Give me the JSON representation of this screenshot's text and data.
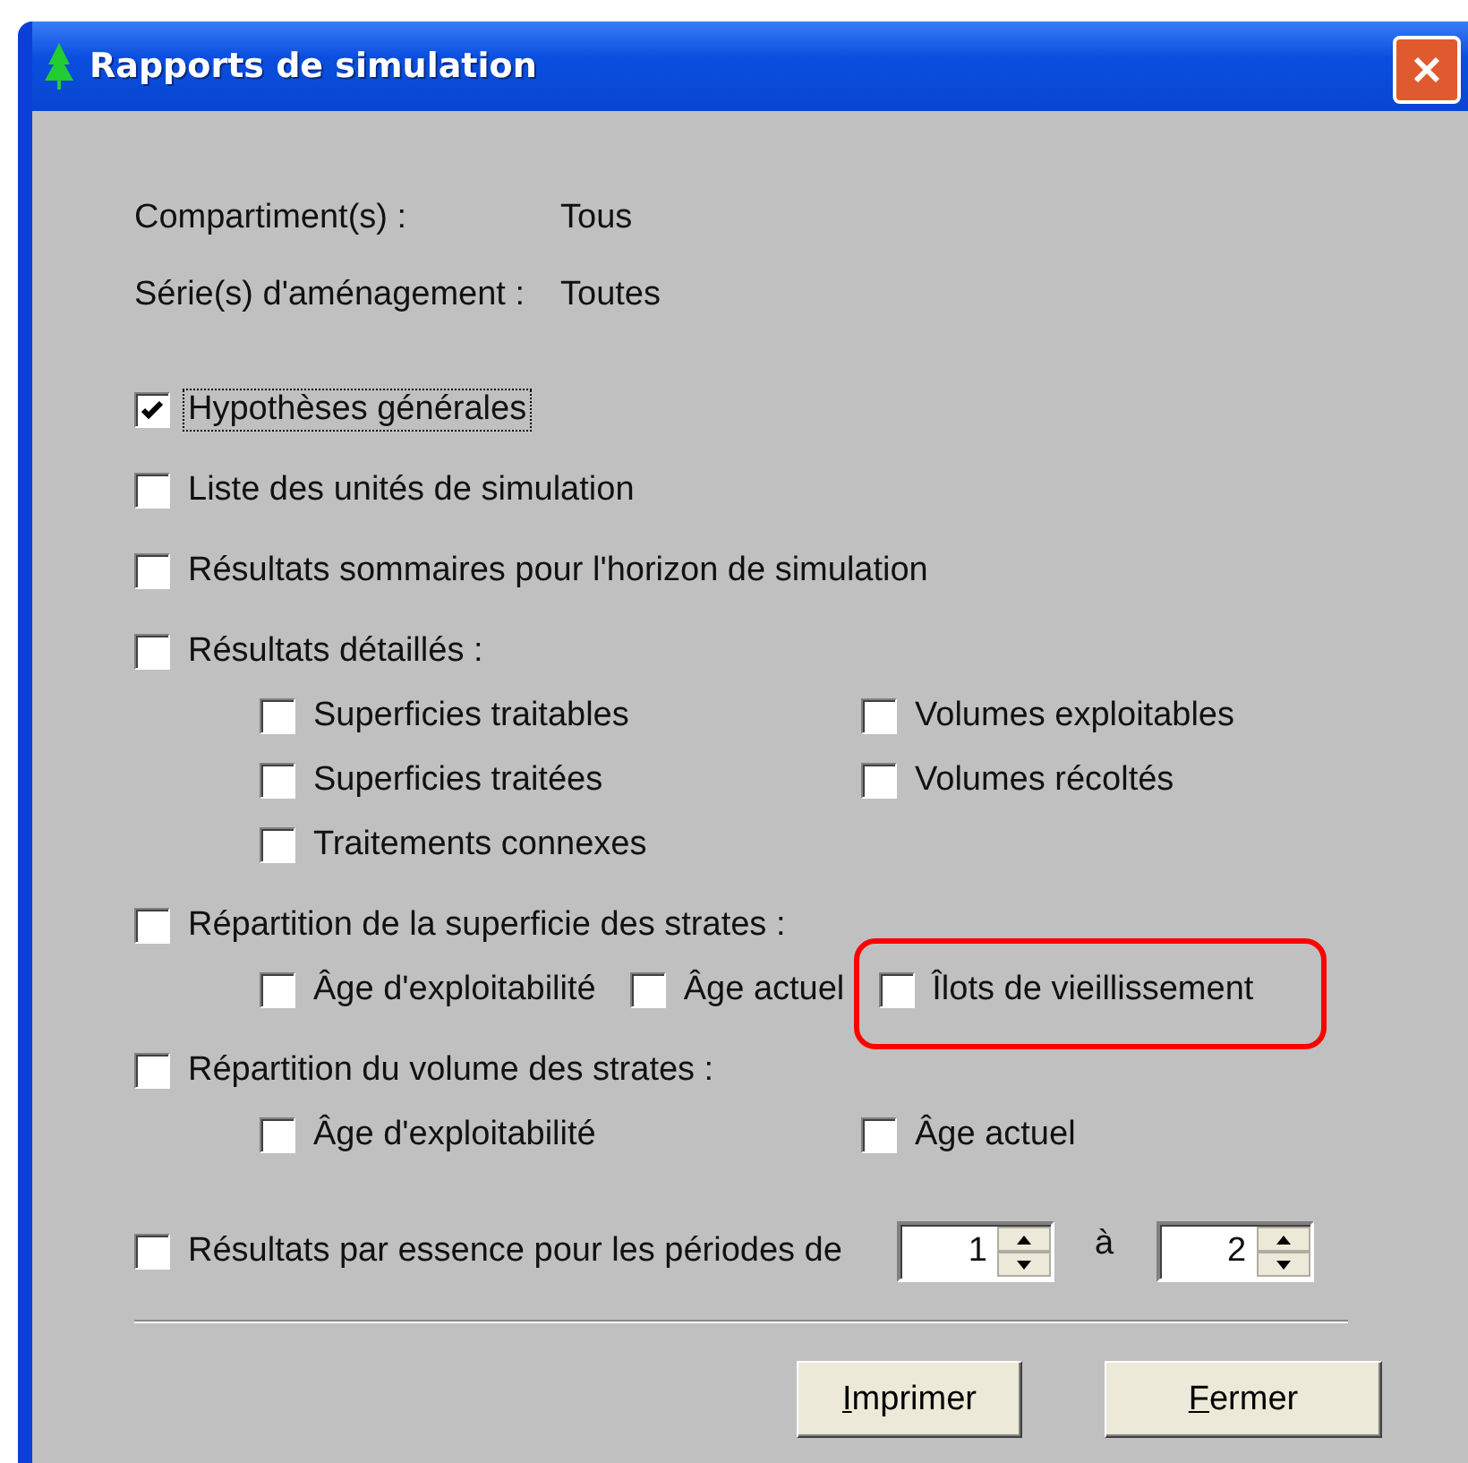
{
  "window": {
    "title": "Rapports de simulation"
  },
  "info": [
    {
      "label": "Compartiment(s) :",
      "value": "Tous"
    },
    {
      "label": "Série(s) d'aménagement :",
      "value": "Toutes"
    }
  ],
  "options": [
    {
      "kind": "check",
      "label": "Hypothèses générales",
      "checked": true,
      "focused": true
    },
    {
      "kind": "check",
      "label": "Liste des unités de simulation",
      "checked": false,
      "focused": false
    },
    {
      "kind": "check",
      "label": "Résultats sommaires pour l'horizon de simulation",
      "checked": false,
      "focused": false
    },
    {
      "kind": "grid",
      "label": "Résultats détaillés :",
      "checked": false,
      "focused": false,
      "children": [
        {
          "label": "Superficies traitables",
          "checked": false,
          "highlighted": false
        },
        {
          "label": "Volumes exploitables",
          "checked": false,
          "highlighted": false
        },
        {
          "label": "Superficies traitées",
          "checked": false,
          "highlighted": false
        },
        {
          "label": "Volumes récoltés",
          "checked": false,
          "highlighted": false
        },
        {
          "label": "Traitements connexes",
          "checked": false,
          "highlighted": false
        }
      ]
    },
    {
      "kind": "strip",
      "label": "Répartition de la superficie des strates :",
      "checked": false,
      "focused": false,
      "children": [
        {
          "label": "Âge d'exploitabilité",
          "checked": false,
          "highlighted": false
        },
        {
          "label": "Âge actuel",
          "checked": false,
          "highlighted": false
        },
        {
          "label": "Îlots de vieillissement",
          "checked": false,
          "highlighted": true
        }
      ]
    },
    {
      "kind": "grid",
      "label": "Répartition du volume des strates :",
      "checked": false,
      "focused": false,
      "children": [
        {
          "label": "Âge d'exploitabilité",
          "checked": false,
          "highlighted": false
        },
        {
          "label": "Âge actuel",
          "checked": false,
          "highlighted": false
        }
      ]
    },
    {
      "kind": "range",
      "label": "Résultats par essence pour les périodes de",
      "checked": false,
      "focused": false,
      "from": "1",
      "joiner": "à",
      "to": "2"
    }
  ],
  "buttons": [
    "Imprimer",
    "Fermer"
  ]
}
